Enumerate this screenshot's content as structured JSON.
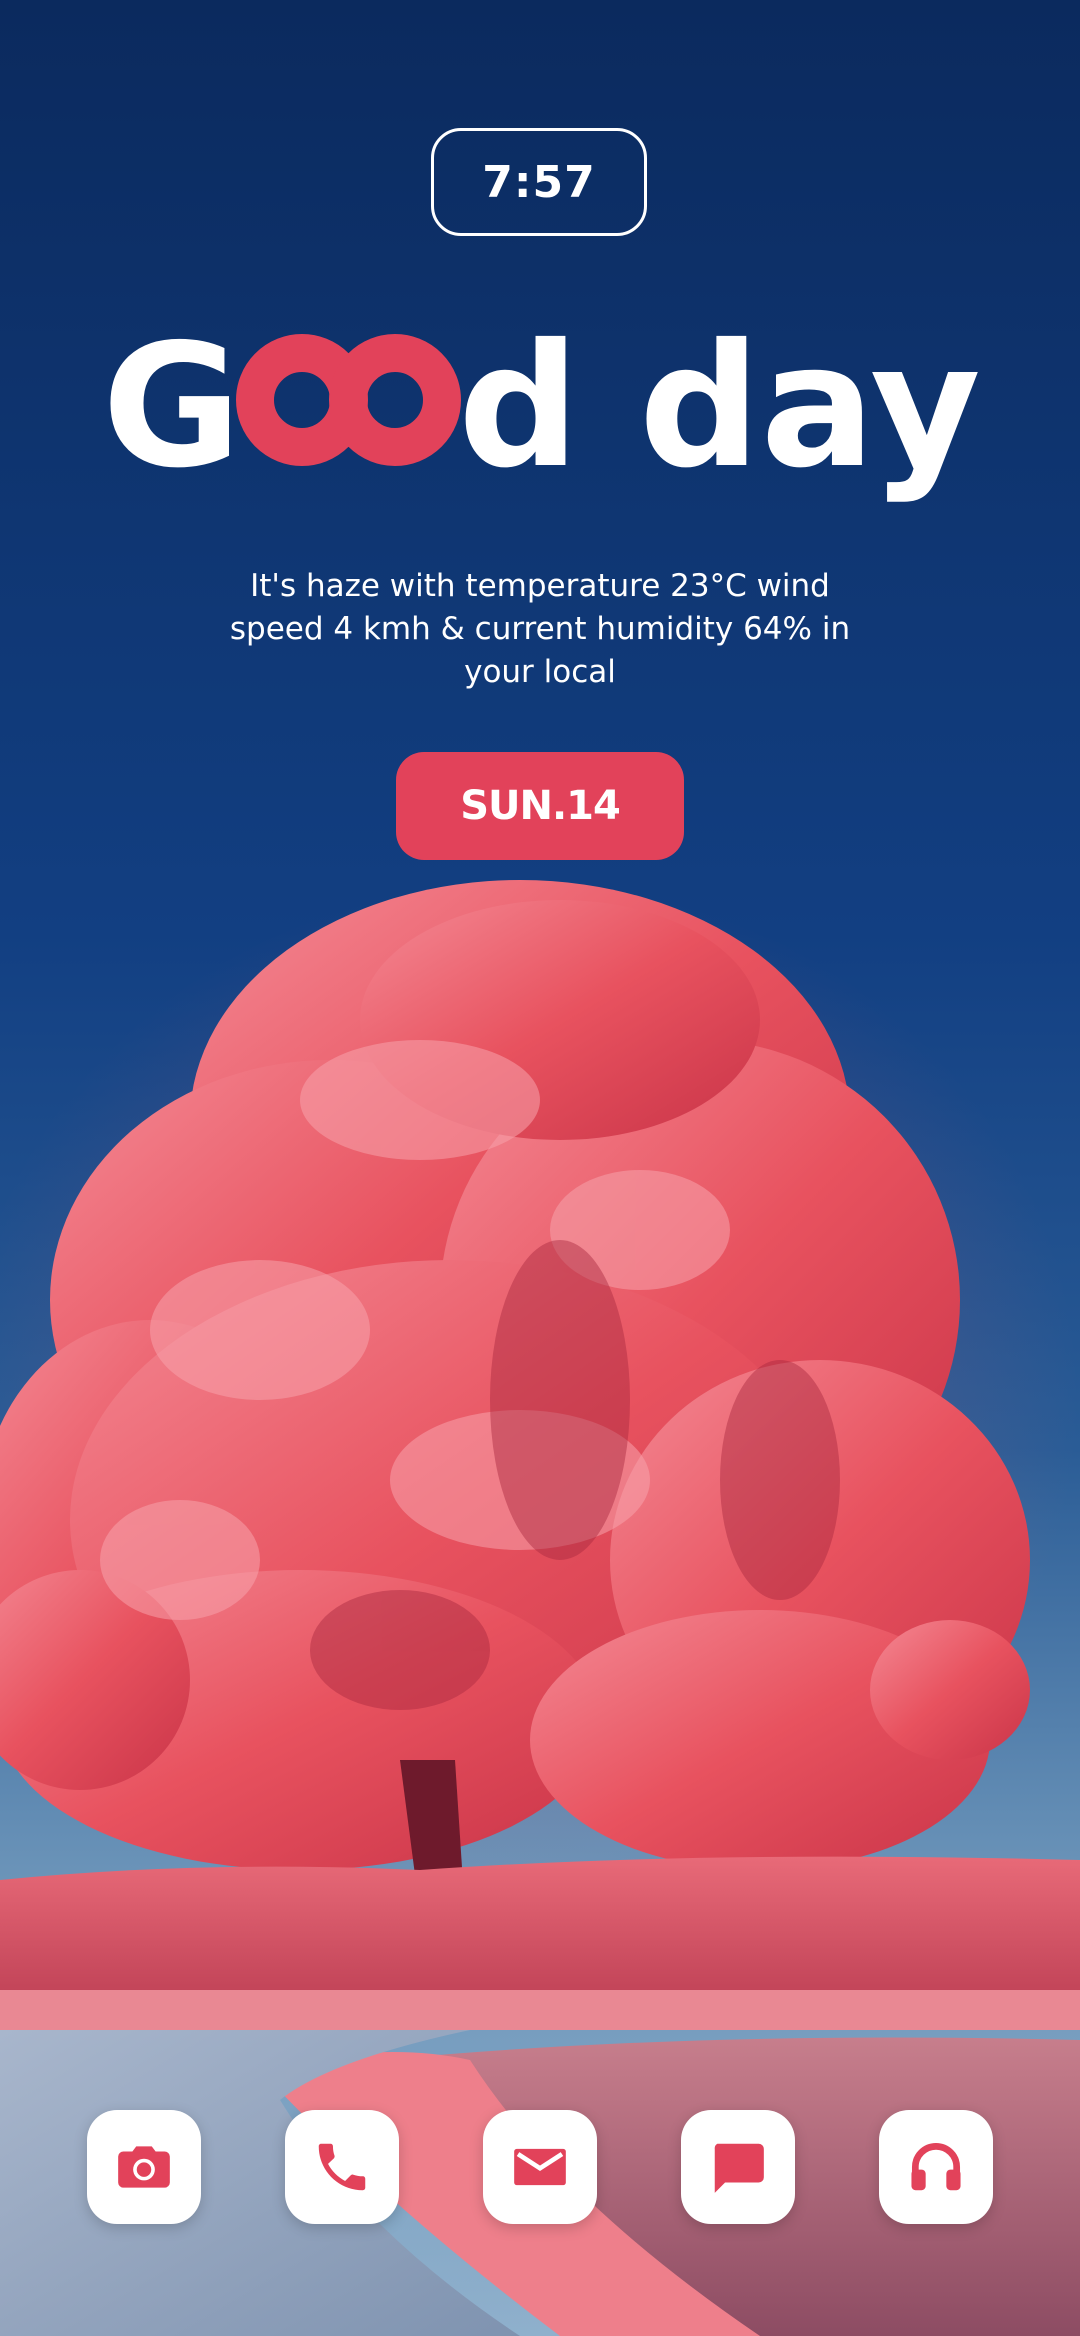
{
  "clock": {
    "time": "7:57"
  },
  "greeting": {
    "part1": "G",
    "part2": "d day"
  },
  "weather": {
    "text": "It's haze with temperature 23°C wind speed 4 kmh & current humidity 64% in your local"
  },
  "date": {
    "label": "SUN.14"
  },
  "colors": {
    "accent": "#e2425a",
    "sky_top": "#0b2a5e",
    "sky_mid": "#123f82",
    "white": "#ffffff"
  },
  "dock": {
    "items": [
      {
        "icon": "camera-icon"
      },
      {
        "icon": "phone-icon"
      },
      {
        "icon": "mail-icon"
      },
      {
        "icon": "chat-icon"
      },
      {
        "icon": "headphones-icon"
      }
    ]
  }
}
